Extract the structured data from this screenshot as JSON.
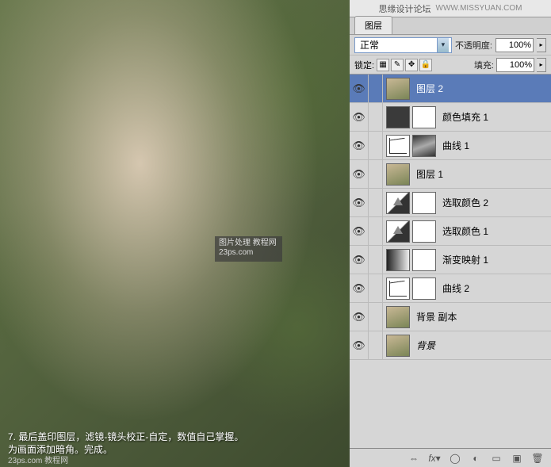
{
  "titlebar": {
    "name": "思缘设计论坛",
    "url": "WWW.MISSYUAN.COM"
  },
  "tab": {
    "label": "图层"
  },
  "blend": {
    "mode": "正常",
    "opacity_label": "不透明度:",
    "opacity_value": "100%"
  },
  "lock": {
    "label": "锁定:",
    "fill_label": "填充:",
    "fill_value": "100%"
  },
  "layers": [
    {
      "name": "图层 2",
      "type": "img",
      "selected": true,
      "mask": false
    },
    {
      "name": "颜色填充 1",
      "type": "solid",
      "selected": false,
      "mask": true
    },
    {
      "name": "曲线 1",
      "type": "curves",
      "selected": false,
      "mask": true,
      "maskPainted": true
    },
    {
      "name": "图层 1",
      "type": "img",
      "selected": false,
      "mask": false
    },
    {
      "name": "选取颜色 2",
      "type": "selcolor",
      "selected": false,
      "mask": true
    },
    {
      "name": "选取颜色 1",
      "type": "selcolor",
      "selected": false,
      "mask": true
    },
    {
      "name": "渐变映射 1",
      "type": "gradmap",
      "selected": false,
      "mask": true
    },
    {
      "name": "曲线 2",
      "type": "curves",
      "selected": false,
      "mask": true
    },
    {
      "name": "背景 副本",
      "type": "img",
      "selected": false,
      "mask": false
    },
    {
      "name": "背景",
      "type": "img",
      "selected": false,
      "mask": false,
      "italic": true
    }
  ],
  "watermark": {
    "line1": "图片处理 教程网",
    "line2": "23ps.com"
  },
  "caption": {
    "line1": "7. 最后盖印图层，滤镜-镜头校正-自定，数值自己掌握。",
    "line2": "为画面添加暗角。完成。",
    "url": "23ps.com 教程网"
  }
}
